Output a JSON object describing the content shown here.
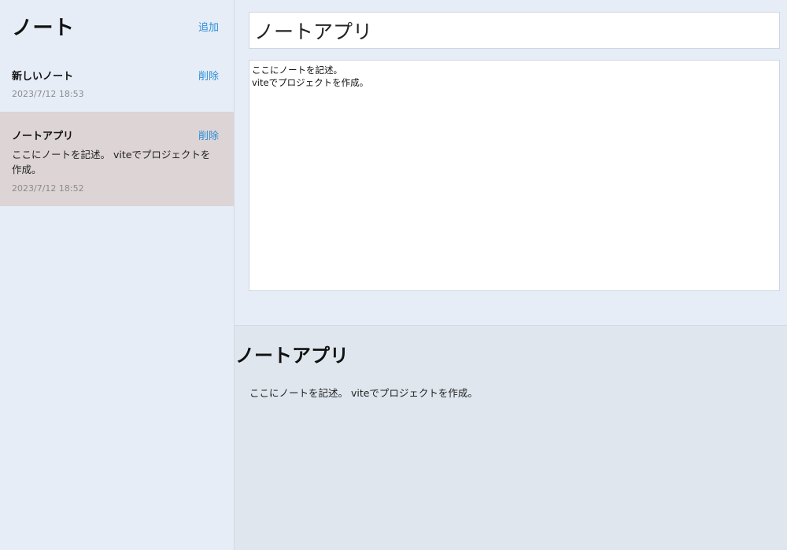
{
  "sidebar": {
    "title": "ノート",
    "add_label": "追加",
    "notes": [
      {
        "title": "新しいノート",
        "delete_label": "削除",
        "body": "",
        "date": "2023/7/12 18:53"
      },
      {
        "title": "ノートアプリ",
        "delete_label": "削除",
        "body": "ここにノートを記述。 viteでプロジェクトを作成。",
        "date": "2023/7/12 18:52"
      }
    ]
  },
  "editor": {
    "title_value": "ノートアプリ",
    "body_value": "ここにノートを記述。\nviteでプロジェクトを作成。"
  },
  "preview": {
    "title": "ノートアプリ",
    "body": "ここにノートを記述。 viteでプロジェクトを作成。"
  },
  "colors": {
    "accent": "#2a8fd8",
    "active_note_bg": "#dcd4d5",
    "app_bg": "#e6edf7",
    "preview_bg": "#dfe6ee"
  }
}
